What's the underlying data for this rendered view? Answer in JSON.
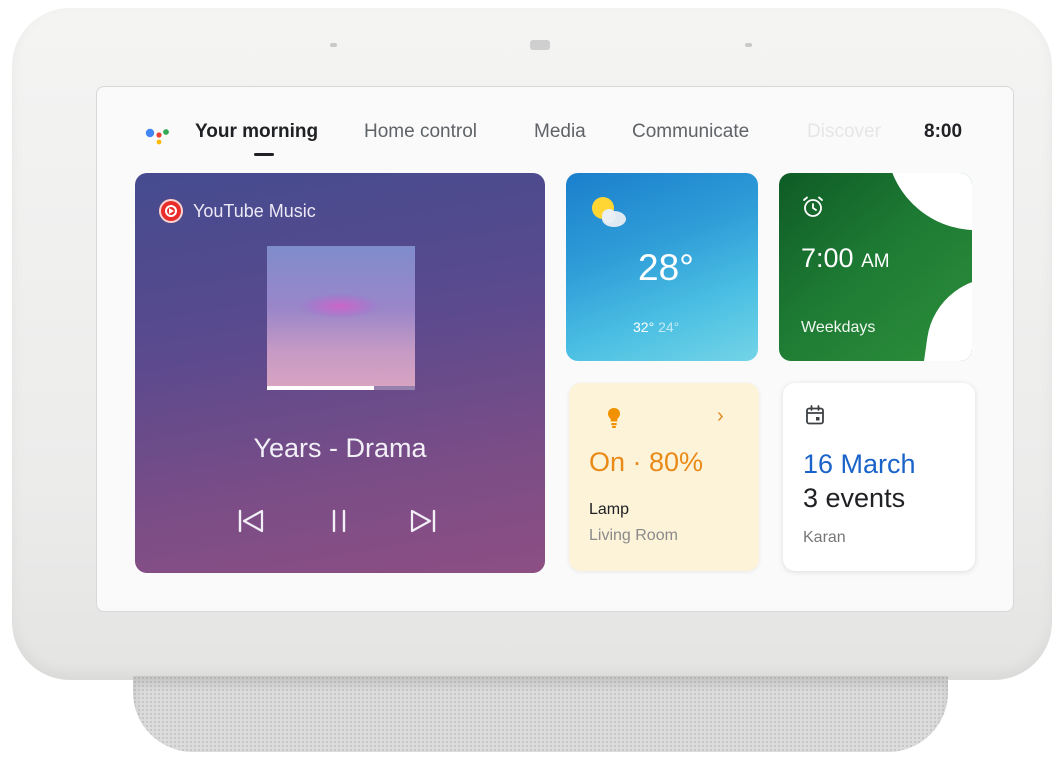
{
  "device": {
    "name": "Smart display"
  },
  "topbar": {
    "tabs": [
      {
        "label": "Your morning",
        "active": true
      },
      {
        "label": "Home control"
      },
      {
        "label": "Media"
      },
      {
        "label": "Communicate"
      },
      {
        "label": "Discover"
      }
    ],
    "time": "8:00",
    "assistant_icon": "google-assistant-icon"
  },
  "music": {
    "service": "YouTube Music",
    "service_icon": "youtube-music-icon",
    "track": "Years - Drama",
    "progress": 0.72,
    "controls": [
      "previous-icon",
      "pause-icon",
      "next-icon"
    ],
    "gradient_colors": [
      "#454b8f",
      "#8c4f84"
    ]
  },
  "weather": {
    "icon": "partly-sunny-icon",
    "temperature": "28°",
    "high": "32°",
    "low": "24°",
    "colors": [
      "#1b7fcc",
      "#73d4e6"
    ]
  },
  "alarm": {
    "icon": "alarm-clock-icon",
    "time": "7:00",
    "ampm": "AM",
    "repeat": "Weekdays",
    "color": "#1d7a33"
  },
  "lamp": {
    "icon": "lightbulb-icon",
    "status": "On · 80%",
    "name": "Lamp",
    "room": "Living Room",
    "accent": "#e98a18"
  },
  "calendar": {
    "icon": "calendar-icon",
    "date": "16 March",
    "events": "3 events",
    "person": "Karan",
    "accent": "#1a63c8"
  }
}
